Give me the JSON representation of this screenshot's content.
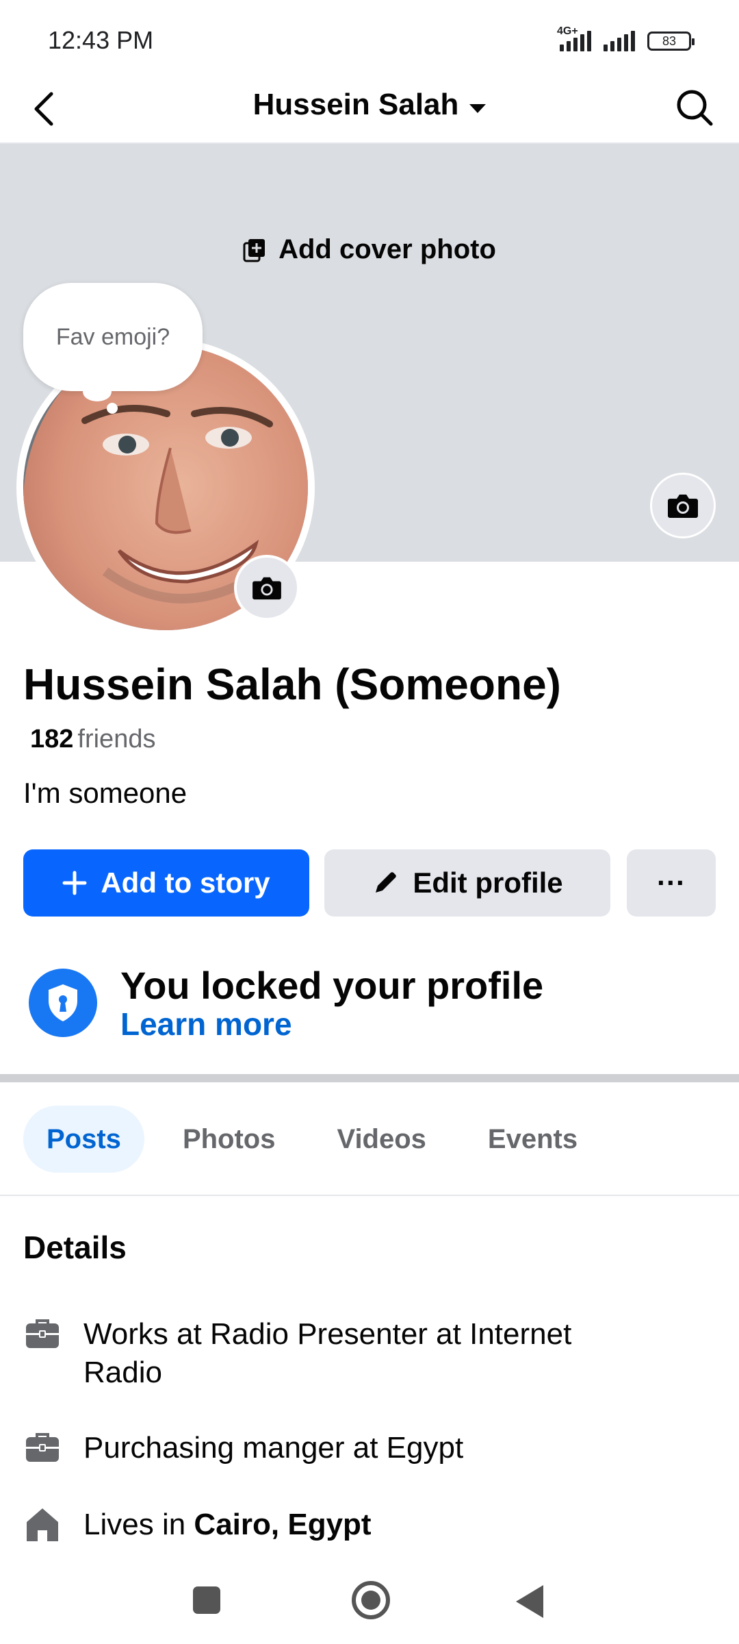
{
  "status_bar": {
    "time": "12:43 PM",
    "network": "4G+",
    "battery": "83"
  },
  "header": {
    "title": "Hussein Salah"
  },
  "cover": {
    "add_cover_label": "Add cover photo"
  },
  "note": {
    "text": "Fav emoji?"
  },
  "profile": {
    "name": "Hussein Salah (Someone)",
    "friends_count": "182",
    "friends_label": "friends",
    "bio": "I'm someone"
  },
  "actions": {
    "add_story_label": "Add to story",
    "edit_profile_label": "Edit profile",
    "more_label": "···"
  },
  "locked": {
    "title": "You locked your profile",
    "link": "Learn more"
  },
  "tabs": [
    {
      "label": "Posts",
      "active": true
    },
    {
      "label": "Photos",
      "active": false
    },
    {
      "label": "Videos",
      "active": false
    },
    {
      "label": "Events",
      "active": false
    }
  ],
  "details": {
    "heading": "Details",
    "items": [
      {
        "icon": "briefcase-icon",
        "text": "Works at Radio Presenter at Internet Radio"
      },
      {
        "icon": "briefcase-icon",
        "text": "Purchasing manger at Egypt"
      },
      {
        "icon": "home-icon",
        "prefix": "Lives in ",
        "bold": "Cairo, Egypt"
      }
    ]
  },
  "colors": {
    "accent": "#0866ff",
    "link": "#0064d1",
    "cover_bg": "#dadde1",
    "button_gray": "#e4e6eb"
  }
}
